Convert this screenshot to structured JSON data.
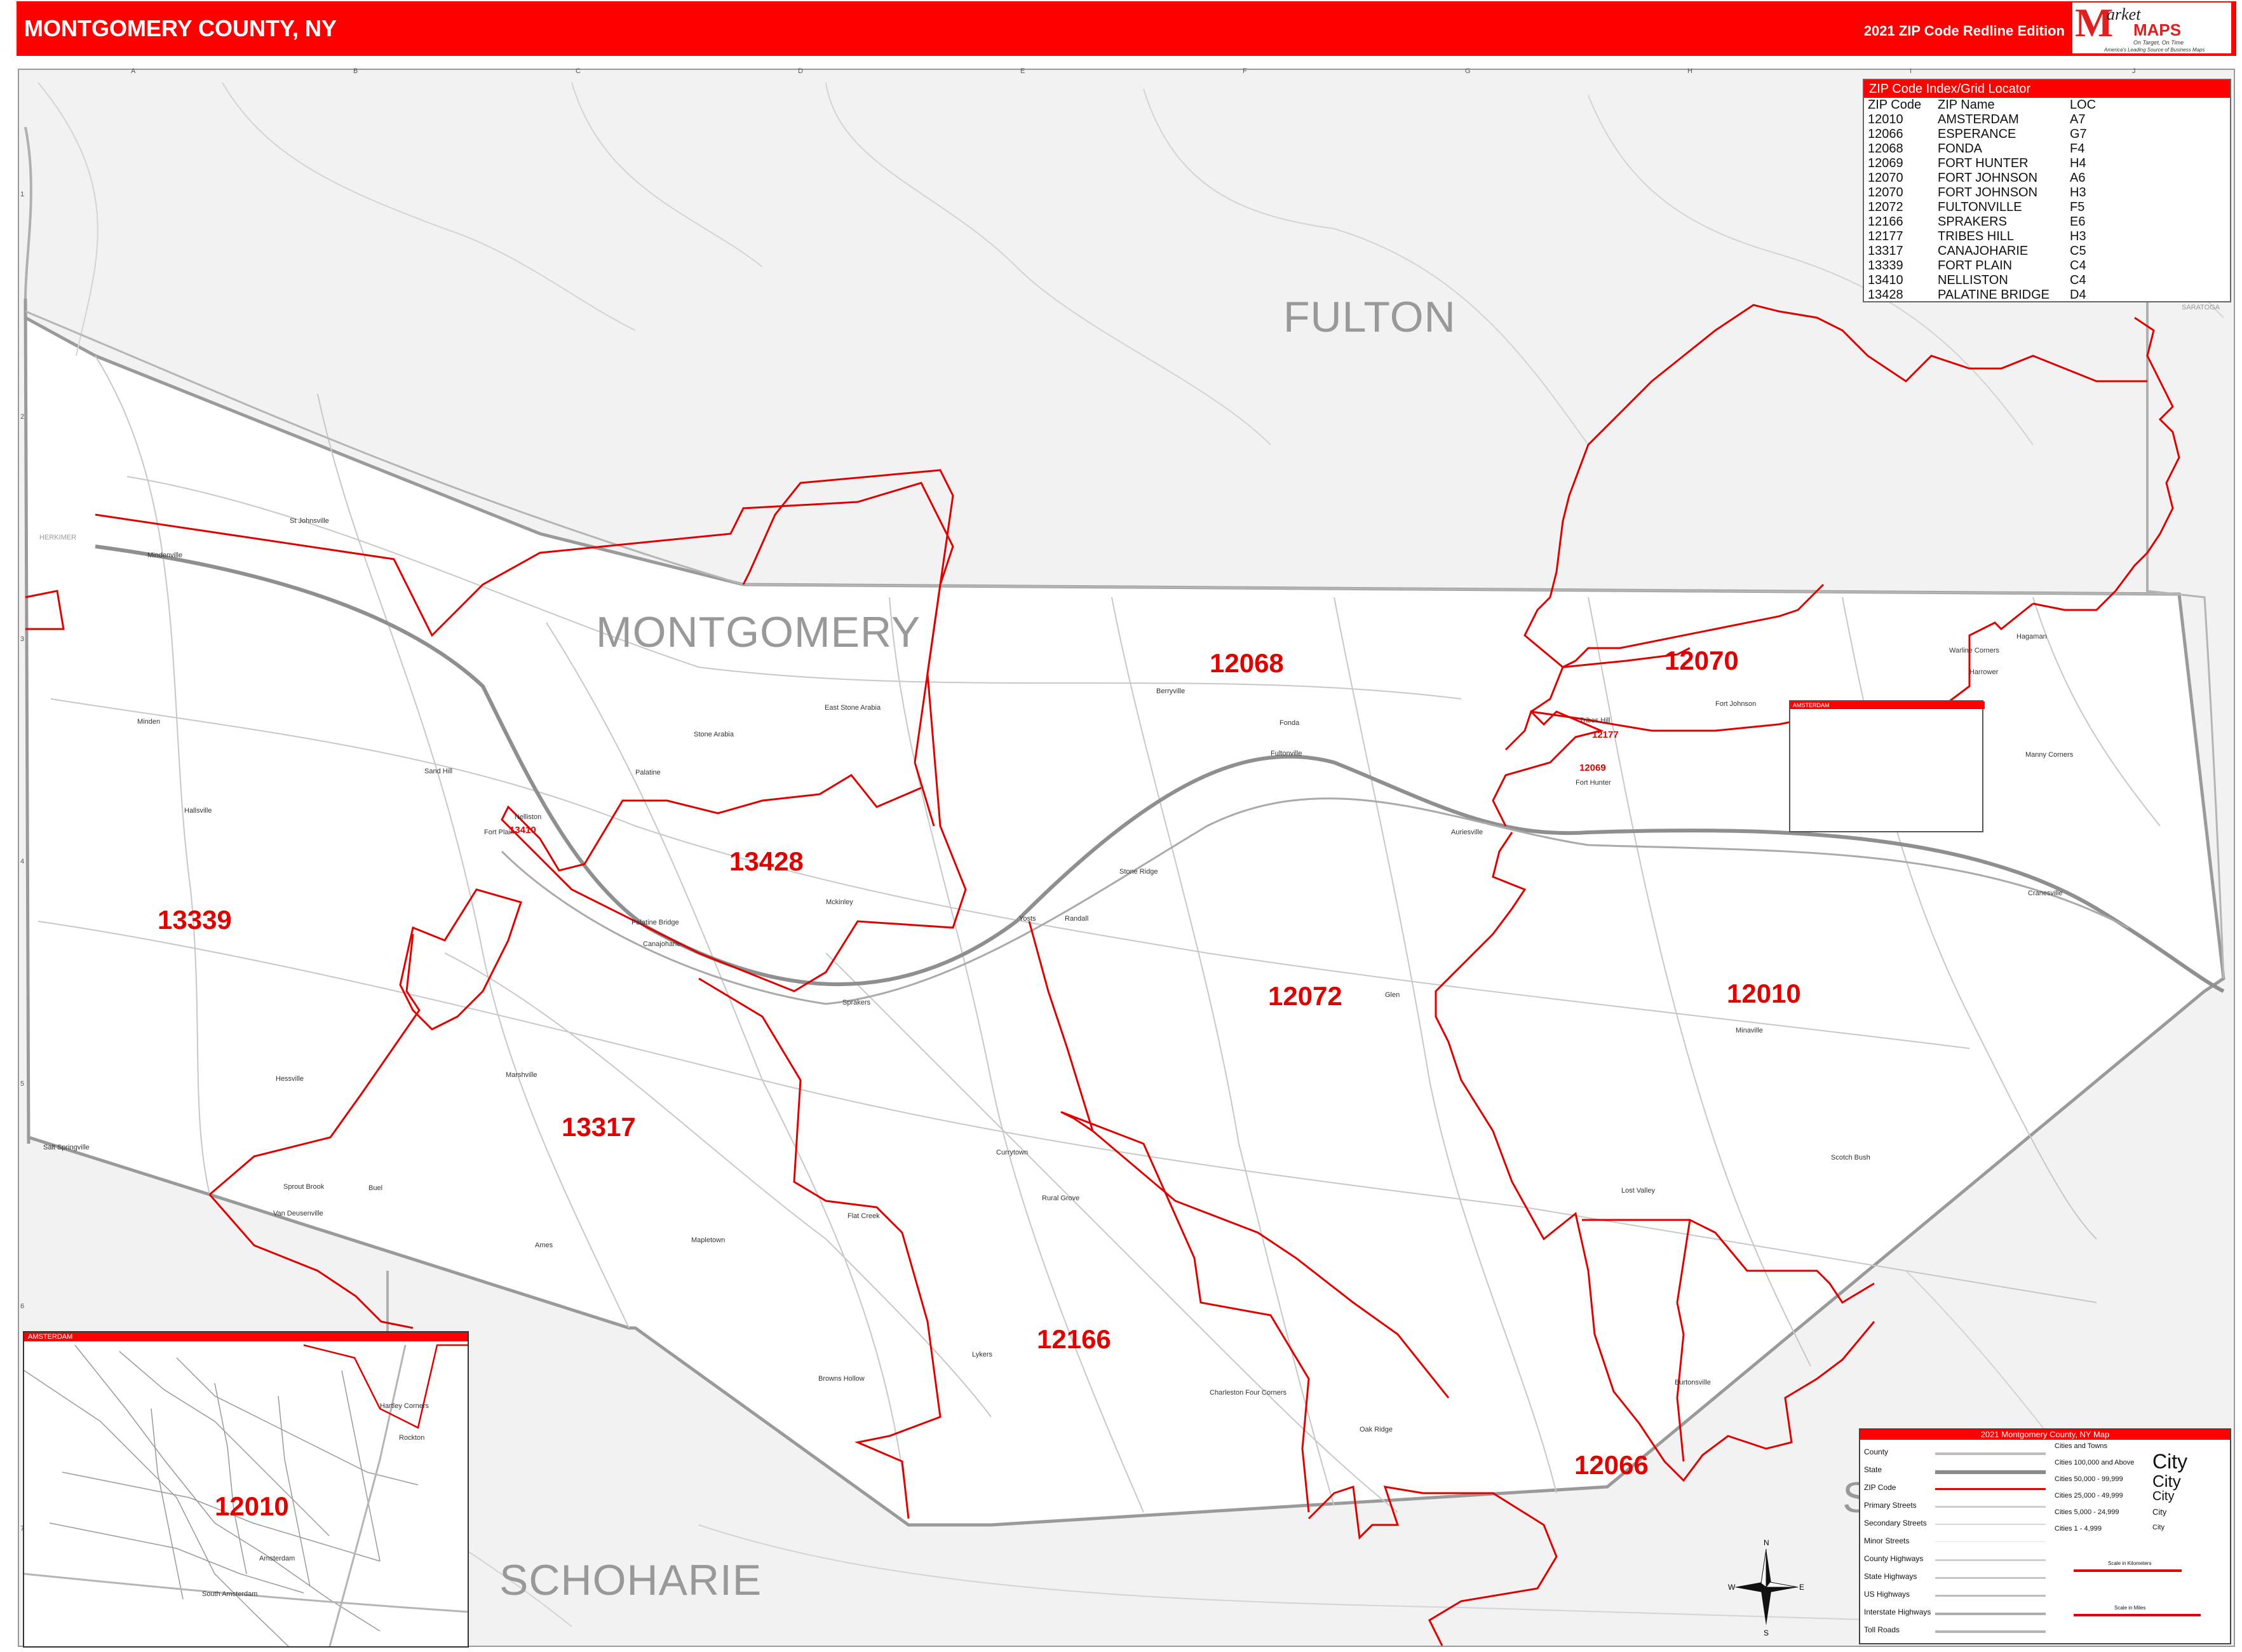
{
  "header": {
    "title": "MONTGOMERY COUNTY, NY",
    "edition": "2021 ZIP Code Redline Edition",
    "logo": {
      "brand_top": "arket",
      "brand_bottom": "MAPS",
      "tagline1": "On Target, On Time",
      "tagline2": "America's Leading Source of Business Maps"
    }
  },
  "colors": {
    "accent": "#ff0000",
    "county_fill": "#ffffff",
    "outside_fill": "#f2f2f2",
    "zip_line": "#e00000",
    "road": "#c8c8c8"
  },
  "county_labels": {
    "fulton": "FULTON",
    "montgomery": "MONTGOMERY",
    "schoharie": "SCHOHARIE",
    "herkimer": "HERKIMER",
    "saratoga": "SARATOGA",
    "s_fragment": "S"
  },
  "zip_labels": {
    "z13339": "13339",
    "z13428": "13428",
    "z13317": "13317",
    "z12068": "12068",
    "z12070": "12070",
    "z12072": "12072",
    "z12010": "12010",
    "z12166": "12166",
    "z12066": "12066",
    "z13410": "13410",
    "z12177": "12177",
    "z12069": "12069",
    "inset_12010": "12010"
  },
  "places": {
    "st_johnsville": "St Johnsville",
    "mindenville": "Mindenville",
    "minden": "Minden",
    "sand_hill": "Sand Hill",
    "nelliston": "Nelliston",
    "fort_plain": "Fort Plain",
    "hallsville": "Hallsville",
    "palatine": "Palatine",
    "stone_arabia": "Stone Arabia",
    "east_stone_arabia": "East Stone Arabia",
    "palatine_bridge": "Palatine Bridge",
    "canajoharie": "Canajoharie",
    "mckinley": "Mckinley",
    "sprakers": "Sprakers",
    "yosts": "Yosts",
    "randall": "Randall",
    "stone_ridge": "Stone Ridge",
    "berryville": "Berryville",
    "fonda": "Fonda",
    "fultonville": "Fultonville",
    "auriesville": "Auriesville",
    "glen": "Glen",
    "tribes_hill": "Tribes Hill",
    "fort_hunter": "Fort Hunter",
    "fort_johnson": "Fort Johnson",
    "hagaman": "Hagaman",
    "harrower": "Harrower",
    "manny_corners": "Manny Corners",
    "cranesville": "Cranesville",
    "minaville": "Minaville",
    "scotch_bush": "Scotch Bush",
    "lost_valley": "Lost Valley",
    "burtonsville": "Burtonsville",
    "oak_ridge": "Oak Ridge",
    "charleston_four_corners": "Charleston Four Corners",
    "lykers": "Lykers",
    "browns_hollow": "Browns Hollow",
    "rural_grove": "Rural Grove",
    "currytown": "Currytown",
    "flat_creek": "Flat Creek",
    "mapletown": "Mapletown",
    "ames": "Ames",
    "buel": "Buel",
    "sprout_brook": "Sprout Brook",
    "van_deusenville": "Van Deusenville",
    "salt_springville": "Salt Springville",
    "hessville": "Hessville",
    "marshville": "Marshville",
    "amsterdam": "Amsterdam",
    "south_amsterdam": "South Amsterdam",
    "rockton": "Rockton",
    "hartley_corners": "Hartley Corners",
    "warline_corners": "Warline Corners"
  },
  "index": {
    "title": "ZIP Code Index/Grid Locator",
    "headers": [
      "ZIP Code",
      "ZIP Name",
      "LOC"
    ],
    "rows": [
      [
        "12010",
        "AMSTERDAM",
        "A7"
      ],
      [
        "12066",
        "ESPERANCE",
        "G7"
      ],
      [
        "12068",
        "FONDA",
        "F4"
      ],
      [
        "12069",
        "FORT HUNTER",
        "H4"
      ],
      [
        "12070",
        "FORT JOHNSON",
        "A6"
      ],
      [
        "12070",
        "FORT JOHNSON",
        "H3"
      ],
      [
        "12072",
        "FULTONVILLE",
        "F5"
      ],
      [
        "12166",
        "SPRAKERS",
        "E6"
      ],
      [
        "12177",
        "TRIBES HILL",
        "H3"
      ],
      [
        "13317",
        "CANAJOHARIE",
        "C5"
      ],
      [
        "13339",
        "FORT PLAIN",
        "C4"
      ],
      [
        "13410",
        "NELLISTON",
        "C4"
      ],
      [
        "13428",
        "PALATINE BRIDGE",
        "D4"
      ]
    ]
  },
  "insets": {
    "amsterdam_main": "AMSTERDAM",
    "amsterdam_small": "AMSTERDAM"
  },
  "legend": {
    "title": "2021 Montgomery County, NY Map",
    "items": [
      "County",
      "State",
      "ZIP Code",
      "Primary Streets",
      "Secondary Streets",
      "Minor Streets",
      "County Highways",
      "State Highways",
      "US Highways",
      "Interstate Highways",
      "Toll Roads"
    ],
    "cities_header": "Cities and Towns",
    "city_sizes": [
      "Cities 100,000 and Above",
      "Cities 50,000 - 99,999",
      "Cities 25,000 - 49,999",
      "Cities 5,000 - 24,999",
      "Cities 1 - 4,999"
    ],
    "city_word": "City",
    "scale_km": "Scale in Kilometers",
    "scale_mi": "Scale in Miles"
  },
  "grid": {
    "columns": [
      "A",
      "B",
      "C",
      "D",
      "E",
      "F",
      "G",
      "H",
      "I",
      "J"
    ],
    "rows": [
      "1",
      "2",
      "3",
      "4",
      "5",
      "6",
      "7"
    ]
  },
  "compass": {
    "n": "N",
    "s": "S",
    "e": "E",
    "w": "W"
  }
}
